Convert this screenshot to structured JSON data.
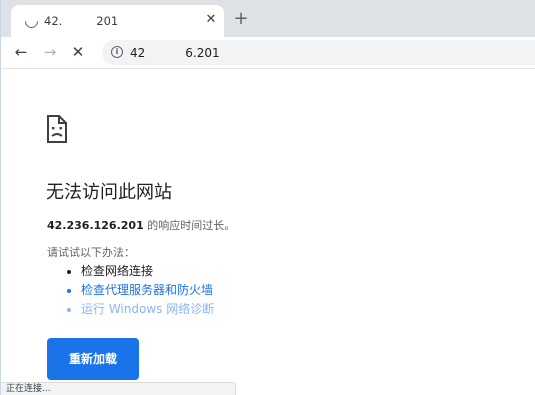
{
  "tab": {
    "title_start": "42.",
    "title_end": "201",
    "close_icon": "close-icon",
    "spinner_icon": "loading-spinner-icon"
  },
  "new_tab_icon": "plus-icon",
  "toolbar": {
    "back_icon": "arrow-left-icon",
    "forward_icon": "arrow-right-icon",
    "stop_icon": "stop-icon",
    "info_icon": "info-icon",
    "url_start": "42",
    "url_end": "6.201"
  },
  "error": {
    "icon": "sad-page-icon",
    "title": "无法访问此网站",
    "host": "42.236.126.201",
    "detail_suffix": " 的响应时间过长。",
    "try_heading": "请试试以下办法：",
    "suggestions": [
      {
        "label": "检查网络连接",
        "style": "plain"
      },
      {
        "label": "检查代理服务器和防火墙",
        "style": "link"
      },
      {
        "label": "运行 Windows 网络诊断",
        "style": "disabled"
      }
    ],
    "reload_label": "重新加载"
  },
  "status_bar": {
    "text": "正在连接..."
  },
  "colors": {
    "accent": "#1a73e8",
    "link": "#1a73e8",
    "disabled_link": "#8ab4f8",
    "tabstrip": "#dee1e6"
  }
}
